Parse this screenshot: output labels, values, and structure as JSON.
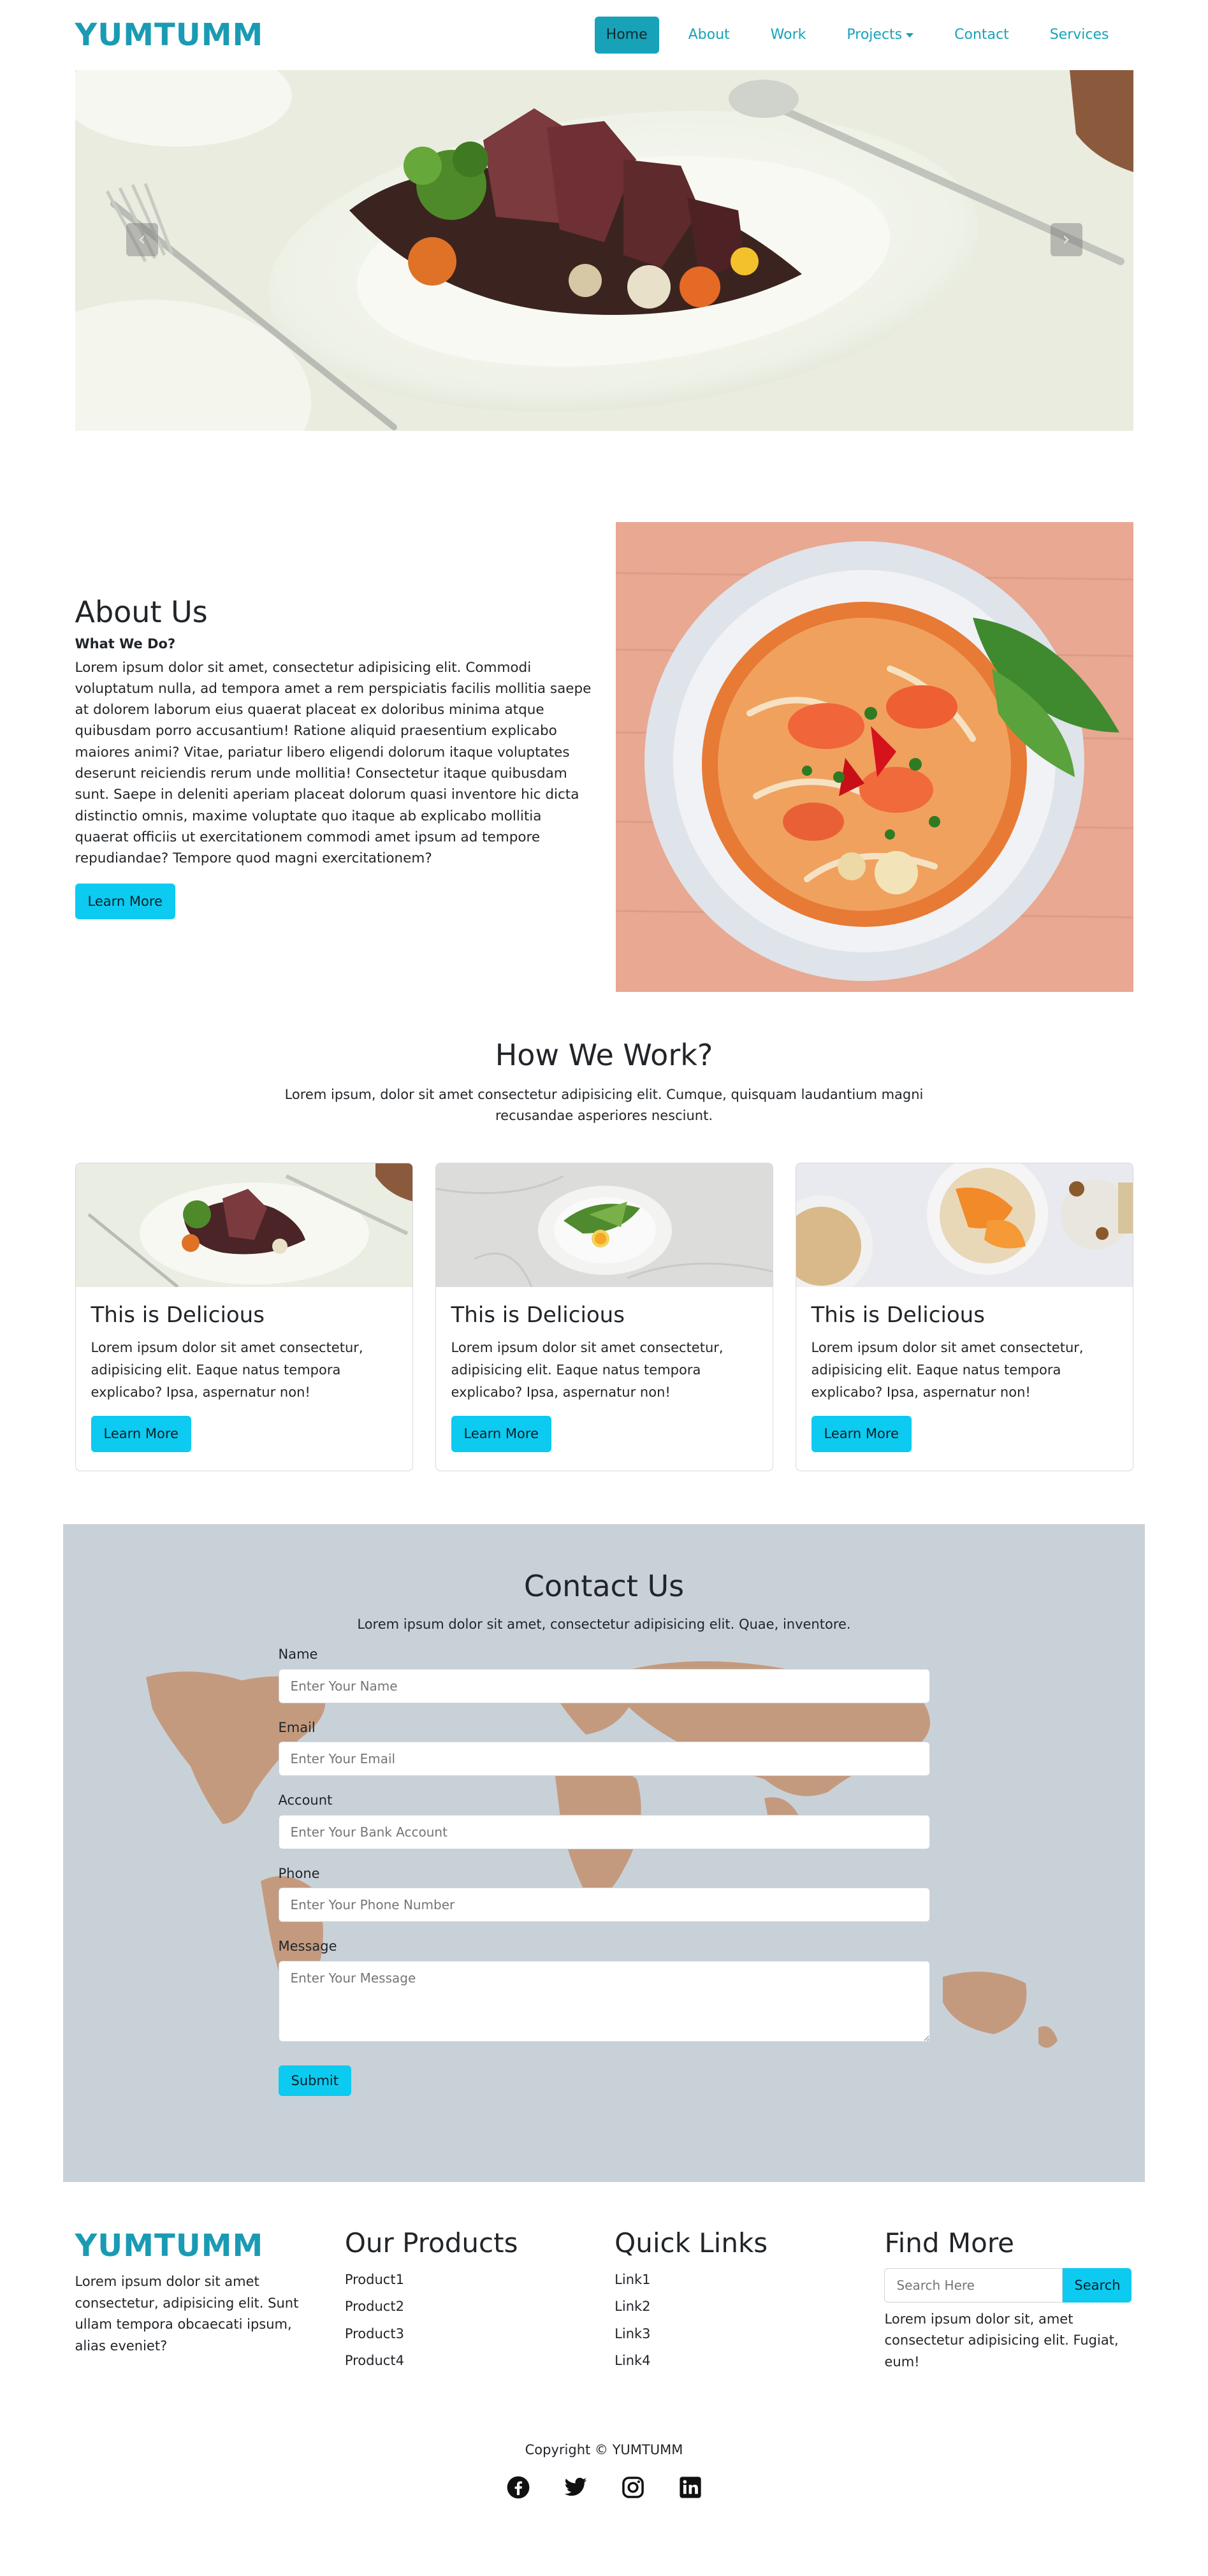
{
  "nav": {
    "brand": "YUMTUMM",
    "links": [
      {
        "label": "Home",
        "active": true
      },
      {
        "label": "About"
      },
      {
        "label": "Work"
      },
      {
        "label": "Projects",
        "dropdown": true
      },
      {
        "label": "Contact"
      },
      {
        "label": "Services"
      }
    ]
  },
  "hero": {
    "prev_icon": "chevron-left-icon",
    "next_icon": "chevron-right-icon"
  },
  "about": {
    "title": "About Us",
    "subtitle": "What We Do?",
    "text": "Lorem ipsum dolor sit amet, consectetur adipisicing elit. Commodi voluptatum nulla, ad tempora amet a rem perspiciatis facilis mollitia saepe at dolorem laborum eius quaerat placeat ex doloribus minima atque quibusdam porro accusantium! Ratione aliquid praesentium explicabo maiores animi? Vitae, pariatur libero eligendi dolorum itaque voluptates deserunt reiciendis rerum unde mollitia! Consectetur itaque quibusdam sunt. Saepe in deleniti aperiam placeat dolorum quasi inventore hic dicta distinctio omnis, maxime voluptate quo itaque ab explicabo mollitia quaerat officiis ut exercitationem commodi amet ipsum ad tempore repudiandae? Tempore quod magni exercitationem?",
    "button": "Learn More"
  },
  "work": {
    "title": "How We Work?",
    "subtitle": "Lorem ipsum, dolor sit amet consectetur adipisicing elit. Cumque, quisquam laudantium magni recusandae asperiores nesciunt.",
    "cards": [
      {
        "title": "This is Delicious",
        "text": "Lorem ipsum dolor sit amet consectetur, adipisicing elit. Eaque natus tempora explicabo? Ipsa, aspernatur non!",
        "button": "Learn More"
      },
      {
        "title": "This is Delicious",
        "text": "Lorem ipsum dolor sit amet consectetur, adipisicing elit. Eaque natus tempora explicabo? Ipsa, aspernatur non!",
        "button": "Learn More"
      },
      {
        "title": "This is Delicious",
        "text": "Lorem ipsum dolor sit amet consectetur, adipisicing elit. Eaque natus tempora explicabo? Ipsa, aspernatur non!",
        "button": "Learn More"
      }
    ]
  },
  "contact": {
    "title": "Contact Us",
    "subtitle": "Lorem ipsum dolor sit amet, consectetur adipisicing elit. Quae, inventore.",
    "fields": [
      {
        "label": "Name",
        "placeholder": "Enter Your Name"
      },
      {
        "label": "Email",
        "placeholder": "Enter Your Email"
      },
      {
        "label": "Account",
        "placeholder": "Enter Your Bank Account"
      },
      {
        "label": "Phone",
        "placeholder": "Enter Your Phone Number"
      }
    ],
    "message": {
      "label": "Message",
      "placeholder": "Enter Your Message"
    },
    "submit": "Submit"
  },
  "footer": {
    "brand": "YUMTUMM",
    "brand_text": "Lorem ipsum dolor sit amet consectetur, adipisicing elit. Sunt ullam tempora obcaecati ipsum, alias eveniet?",
    "products": {
      "title": "Our Products",
      "items": [
        "Product1",
        "Product2",
        "Product3",
        "Product4"
      ]
    },
    "links": {
      "title": "Quick Links",
      "items": [
        "Link1",
        "Link2",
        "Link3",
        "Link4"
      ]
    },
    "find": {
      "title": "Find More",
      "search_placeholder": "Search Here",
      "search_button": "Search",
      "text": "Lorem ipsum dolor sit, amet consectetur adipisicing elit. Fugiat, eum!"
    },
    "copyright": "Copyright © YUMTUMM",
    "socials": [
      "facebook-icon",
      "twitter-icon",
      "instagram-icon",
      "linkedin-icon"
    ]
  },
  "colors": {
    "brand": "#1a9bb3",
    "accent": "#0dcaf0",
    "nav_link": "#17a2b8"
  }
}
